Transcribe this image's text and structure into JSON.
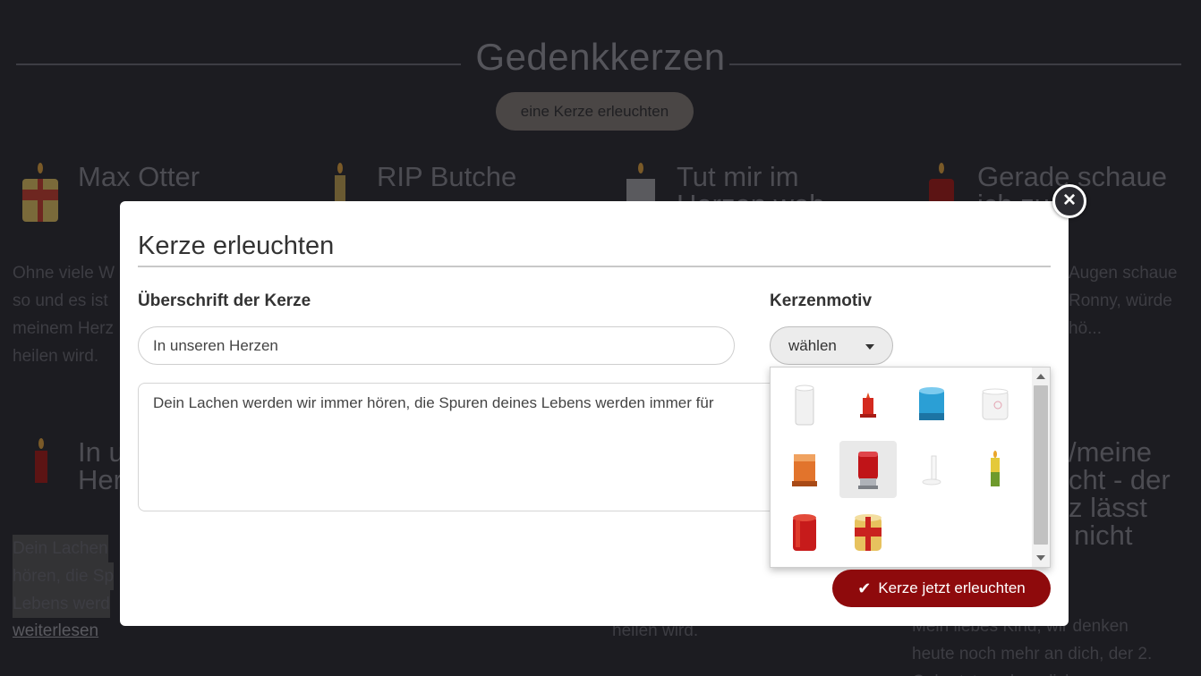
{
  "page": {
    "title": "Gedenkkerzen",
    "light_button": "eine Kerze erleuchten"
  },
  "cards": [
    {
      "title": "Max Otter",
      "text": [
        "Ohne viele W",
        "so und es ist",
        "meinem Herz",
        "heilen wird."
      ]
    },
    {
      "title": "RIP Butche"
    },
    {
      "title": "Tut mir im",
      "title2": "Herzen weh"
    },
    {
      "title": "Gerade schaue",
      "title2": "ich zu",
      "text": [
        "Augen schaue",
        "Ronny, würde",
        "hö..."
      ]
    },
    {
      "title": "In u",
      "title2": "Her",
      "text": [
        "Dein Lachen",
        "hören, die Sp",
        "Lebens werd"
      ],
      "link": "weiterlesen"
    },
    {
      "title": "/meine",
      "title2": "cht - der",
      "title3": "z lässt",
      "title4": "nicht",
      "text": [
        "Mein liebes Kind, wir denken",
        "heute noch mehr an dich, der 2.",
        "Geburtstag ohne dich..."
      ]
    },
    {
      "text": [
        "heilen wird."
      ]
    }
  ],
  "modal": {
    "title": "Kerze erleuchten",
    "heading_label": "Überschrift der Kerze",
    "heading_value": "In unseren Herzen",
    "message_value": "Dein Lachen werden wir immer hören, die Spuren deines Lebens werden immer für",
    "motif_label": "Kerzenmotiv",
    "motif_select": "wählen",
    "submit_label": "Kerze jetzt erleuchten",
    "close_icon": "close-icon"
  },
  "candle_options": [
    {
      "name": "white-pillar-candle",
      "color": "#eeeeee"
    },
    {
      "name": "small-red-candle",
      "color": "#d42a1f"
    },
    {
      "name": "blue-candle",
      "color": "#2b9fd5"
    },
    {
      "name": "white-glass-candle",
      "color": "#f1f1f1"
    },
    {
      "name": "orange-candle",
      "color": "#e2742c"
    },
    {
      "name": "red-lantern-candle",
      "color": "#c01418",
      "selected": true
    },
    {
      "name": "white-taper-candle",
      "color": "#f7f7f7"
    },
    {
      "name": "green-yellow-candle",
      "color": "#7aa32c"
    },
    {
      "name": "red-pillar-candle",
      "color": "#c71b1b"
    },
    {
      "name": "gold-red-candle",
      "color": "#e7c25e"
    }
  ],
  "colors": {
    "accent": "#8e0a0c",
    "background": "#1c1c21"
  }
}
